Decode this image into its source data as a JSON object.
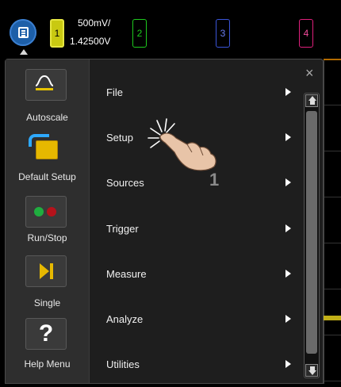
{
  "top_bar": {
    "menu_icon": "main-menu-icon",
    "channels": [
      {
        "number": "1",
        "color": "#c9c911",
        "active": true
      },
      {
        "number": "2",
        "color": "#1ec91e",
        "active": false
      },
      {
        "number": "3",
        "color": "#3a55d8",
        "active": false
      },
      {
        "number": "4",
        "color": "#e0207c",
        "active": false
      }
    ],
    "ch1_scale": "500mV/",
    "ch1_offset": "1.42500V"
  },
  "sidebar": {
    "buttons": [
      {
        "label": "Autoscale",
        "icon": "autoscale-icon"
      },
      {
        "label": "Default Setup",
        "icon": "default-setup-icon"
      },
      {
        "label": "Run/Stop",
        "icon": "run-stop-icon"
      },
      {
        "label": "Single",
        "icon": "single-icon"
      },
      {
        "label": "Help Menu",
        "icon": "help-icon"
      }
    ],
    "help_glyph": "?"
  },
  "menu": {
    "items": [
      {
        "label": "File"
      },
      {
        "label": "Setup"
      },
      {
        "label": "Sources"
      },
      {
        "label": "Trigger"
      },
      {
        "label": "Measure"
      },
      {
        "label": "Analyze"
      },
      {
        "label": "Utilities"
      }
    ],
    "close_glyph": "×"
  },
  "annotation": {
    "step_number": "1",
    "pointer_icon": "tap-hand-icon"
  }
}
